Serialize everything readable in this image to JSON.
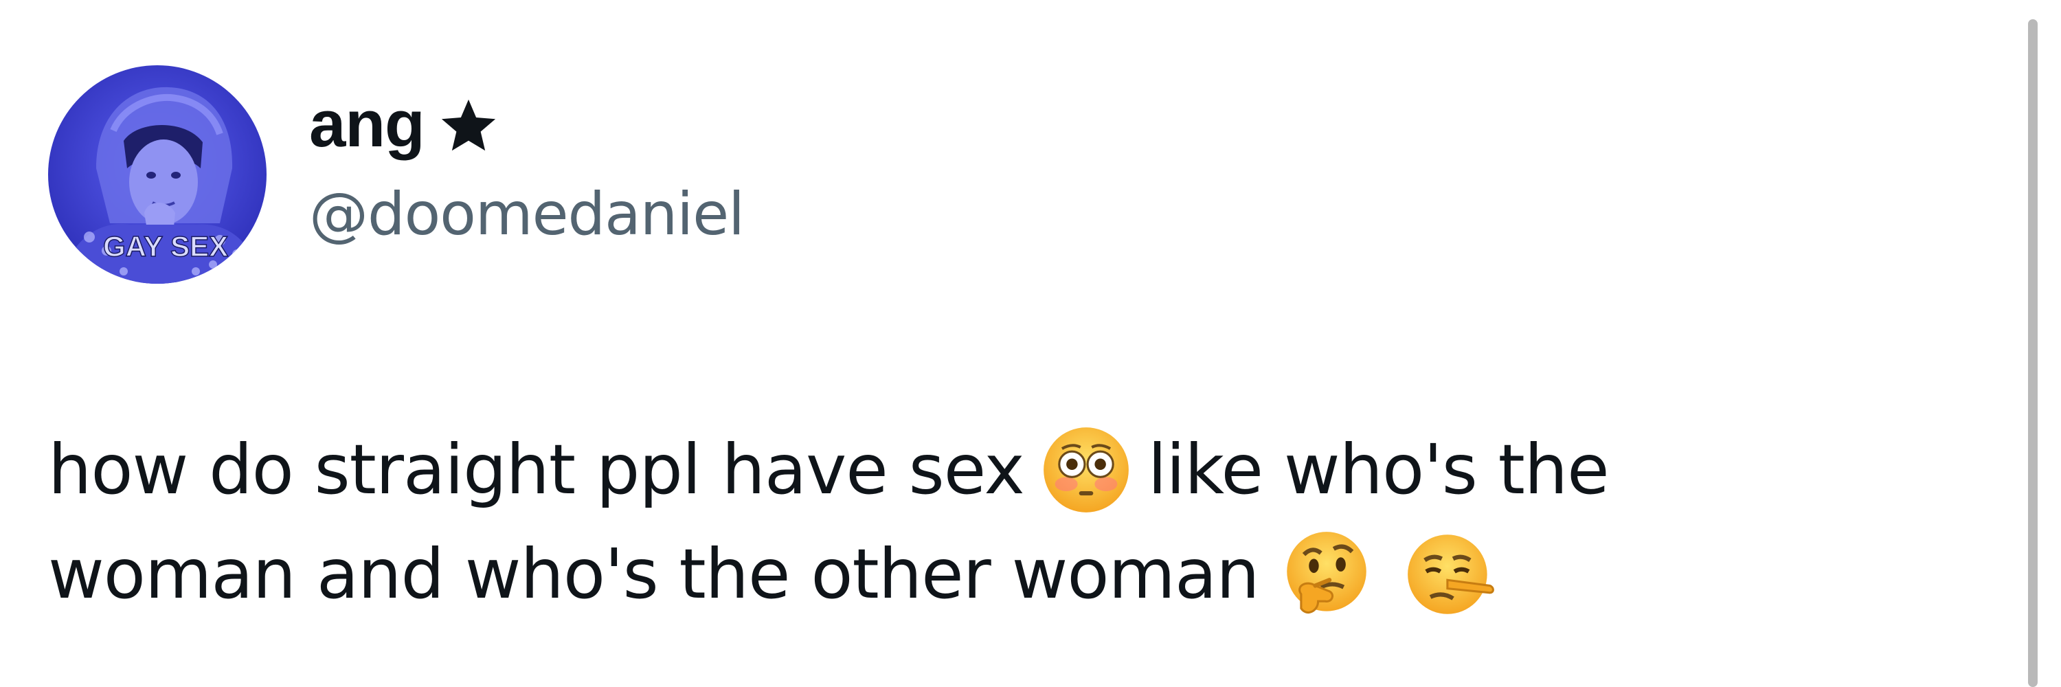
{
  "author": {
    "display_name": "ang",
    "badge_icon": "star-icon",
    "handle": "@doomedaniel",
    "avatar": {
      "overlay_text": "GAY SEX",
      "tint_color": "#3b3fd8"
    }
  },
  "tweet": {
    "line1": {
      "text_before": "how do straight ppl have sex",
      "emoji": "flushed-face-emoji",
      "text_after": "like who's the"
    },
    "line2": {
      "text": "woman and who's the other woman",
      "emojis": [
        "thinking-face-emoji",
        "lying-face-emoji"
      ]
    }
  },
  "colors": {
    "text": "#0f1419",
    "secondary_text": "#536471",
    "background": "#ffffff"
  }
}
